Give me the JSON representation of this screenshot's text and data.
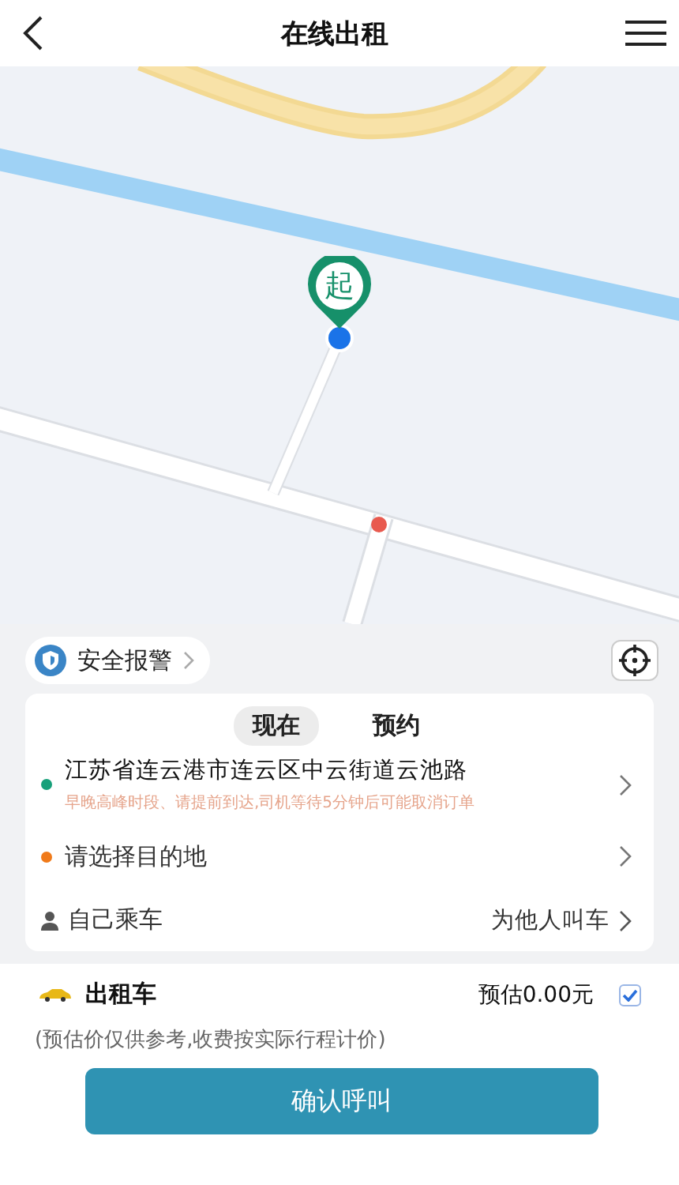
{
  "header": {
    "title": "在线出租"
  },
  "map": {
    "pin_label": "起"
  },
  "safety": {
    "label": "安全报警"
  },
  "tabs": [
    {
      "label": "现在",
      "selected": true
    },
    {
      "label": "预约",
      "selected": false
    }
  ],
  "origin": {
    "address": "江苏省连云港市连云区中云街道云池路",
    "note": "早晚高峰时段、请提前到达,司机等待5分钟后可能取消订单",
    "color": "#17a07a"
  },
  "destination": {
    "placeholder": "请选择目的地",
    "color": "#f07a1a"
  },
  "rider": {
    "self": "自己乘车",
    "other": "为他人叫车"
  },
  "service": {
    "name": "出租车",
    "price": "预估0.00元",
    "checked": true
  },
  "disclaimer": "(预估价仅供参考,收费按实际行程计价)",
  "confirm": "确认呼叫"
}
